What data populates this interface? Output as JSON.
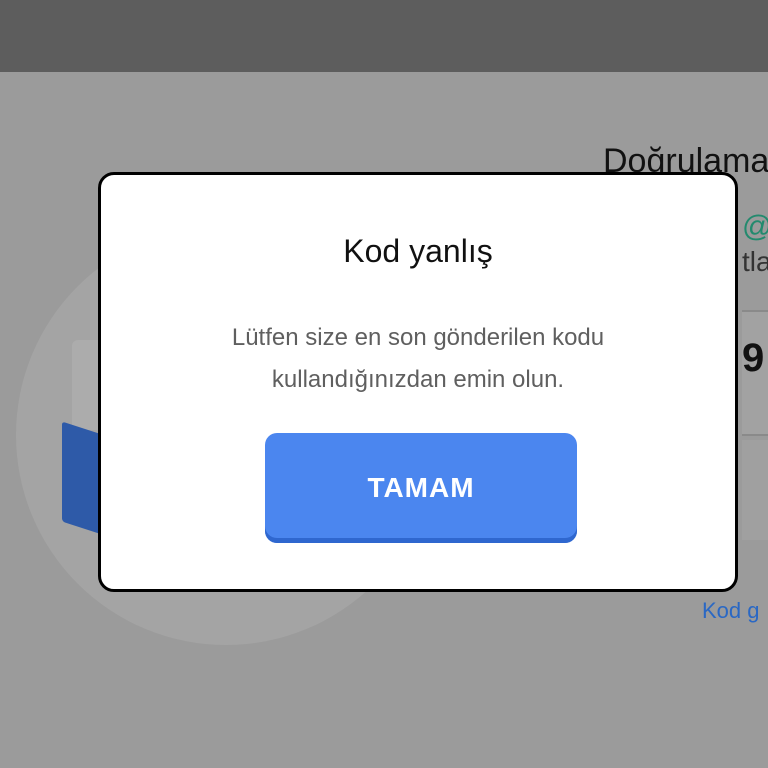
{
  "background": {
    "title": "Doğrulama",
    "email_fragment": "@",
    "subtitle_fragment": "tla",
    "code_digit": "9",
    "resend_link": "Kod g"
  },
  "dialog": {
    "title": "Kod yanlış",
    "message_line1": "Lütfen size en son gönderilen kodu",
    "message_line2": "kullandığınızdan emin olun.",
    "ok_button": "TAMAM"
  },
  "colors": {
    "primary_button": "#4b86ef",
    "link": "#2a68c4",
    "email": "#238a6e"
  }
}
